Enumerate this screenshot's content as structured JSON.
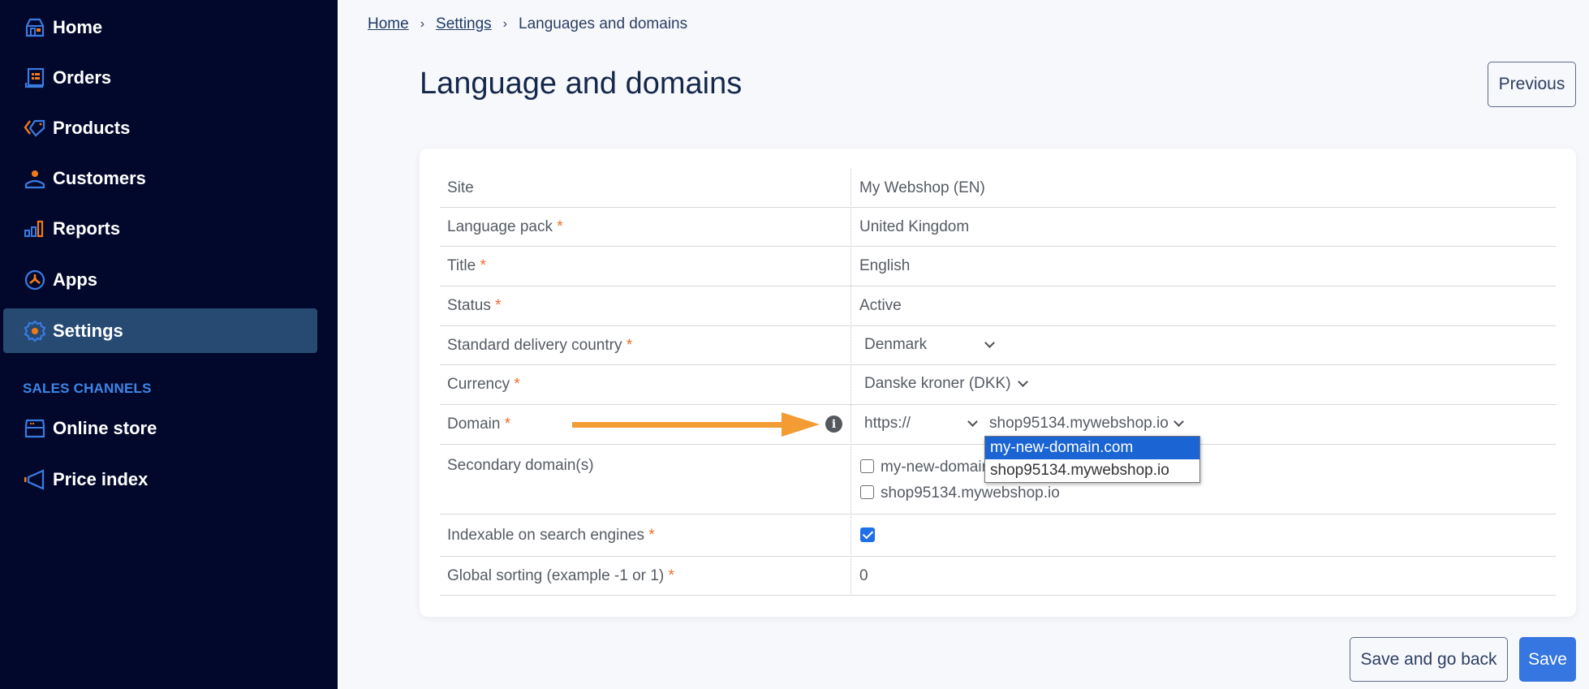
{
  "sidebar": {
    "items": [
      {
        "label": "Home",
        "icon": "home-icon"
      },
      {
        "label": "Orders",
        "icon": "orders-icon"
      },
      {
        "label": "Products",
        "icon": "tag-icon"
      },
      {
        "label": "Customers",
        "icon": "user-icon"
      },
      {
        "label": "Reports",
        "icon": "bar-chart-icon"
      },
      {
        "label": "Apps",
        "icon": "apps-icon"
      },
      {
        "label": "Settings",
        "icon": "gear-icon",
        "active": true
      }
    ],
    "section_label": "SALES CHANNELS",
    "channels": [
      {
        "label": "Online store",
        "icon": "store-icon"
      },
      {
        "label": "Price index",
        "icon": "megaphone-icon"
      }
    ]
  },
  "breadcrumb": {
    "items": [
      "Home",
      "Settings"
    ],
    "current": "Languages and domains",
    "separator": "›"
  },
  "header": {
    "title": "Language and domains",
    "previous_label": "Previous"
  },
  "form": {
    "rows": [
      {
        "label": "Site",
        "required": false,
        "value": "My Webshop (EN)"
      },
      {
        "label": "Language pack",
        "required": true,
        "value": "United Kingdom"
      },
      {
        "label": "Title",
        "required": true,
        "value": "English"
      },
      {
        "label": "Status",
        "required": true,
        "value": "Active"
      },
      {
        "label": "Standard delivery country",
        "required": true,
        "value": "Denmark"
      },
      {
        "label": "Currency",
        "required": true,
        "value": "Danske kroner (DKK)"
      },
      {
        "label": "Domain",
        "required": true,
        "protocol": "https://",
        "value": "shop95134.mywebshop.io"
      },
      {
        "label": "Secondary domain(s)",
        "required": false,
        "options": [
          {
            "label": "my-new-domain.com",
            "checked": false
          },
          {
            "label": "shop95134.mywebshop.io",
            "checked": false
          }
        ]
      },
      {
        "label": "Indexable on search engines",
        "required": true,
        "checked": true
      },
      {
        "label": "Global sorting (example -1 or 1)",
        "required": true,
        "value": "0"
      }
    ],
    "required_marker": "*",
    "info_glyph": "i"
  },
  "domain_dropdown": {
    "options": [
      "my-new-domain.com",
      "shop95134.mywebshop.io"
    ],
    "highlighted": "my-new-domain.com"
  },
  "footer": {
    "save_back_label": "Save and go back",
    "save_label": "Save"
  },
  "colors": {
    "sidebar_bg": "#02082b",
    "sidebar_active": "#274a73",
    "accent_blue": "#3576e0",
    "accent_orange": "#f39c34",
    "required": "#f26b2b"
  }
}
